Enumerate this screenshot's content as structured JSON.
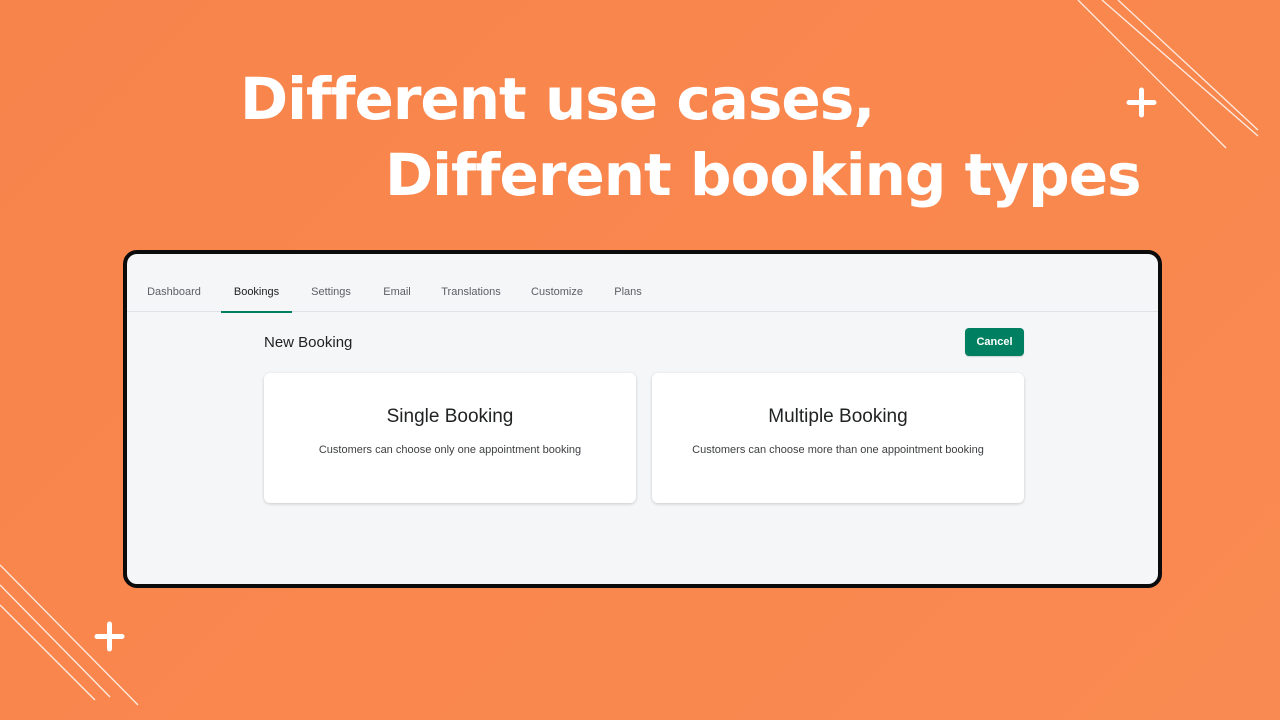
{
  "headline": {
    "line1": "Different use cases,",
    "line2": "Different  booking types"
  },
  "colors": {
    "background": "#f8874d",
    "accent": "#008060",
    "window_border": "#0b0b0b",
    "window_background": "#f5f6f8"
  },
  "tabs": [
    {
      "label": "Dashboard",
      "active": false
    },
    {
      "label": "Bookings",
      "active": true
    },
    {
      "label": "Settings",
      "active": false
    },
    {
      "label": "Email",
      "active": false
    },
    {
      "label": "Translations",
      "active": false
    },
    {
      "label": "Customize",
      "active": false
    },
    {
      "label": "Plans",
      "active": false
    }
  ],
  "page": {
    "title": "New Booking",
    "cancel_label": "Cancel"
  },
  "cards": {
    "single": {
      "title": "Single Booking",
      "description": "Customers can choose only one appointment booking"
    },
    "multiple": {
      "title": "Multiple Booking",
      "description": "Customers can choose more than one appointment booking"
    }
  },
  "decorations": {
    "icons": [
      "plus-icon",
      "plus-icon"
    ]
  }
}
